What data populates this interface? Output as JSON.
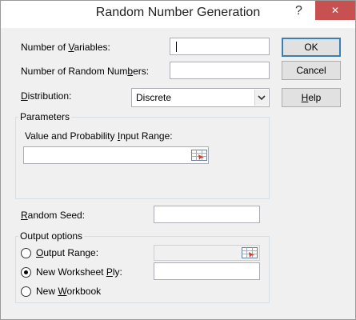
{
  "window": {
    "title": "Random Number Generation",
    "help_glyph": "?",
    "close_glyph": "✕"
  },
  "fields": {
    "num_variables": {
      "pre": "Number of ",
      "key": "V",
      "post": "ariables:",
      "value": ""
    },
    "num_random": {
      "pre": "Number of Random Num",
      "key": "b",
      "post": "ers:",
      "value": ""
    },
    "distribution": {
      "pre": "",
      "key": "D",
      "post": "istribution:",
      "value": "Discrete"
    }
  },
  "buttons": {
    "ok": "OK",
    "cancel": "Cancel",
    "help": {
      "pre": "",
      "key": "H",
      "post": "elp"
    }
  },
  "parameters": {
    "title": "Parameters",
    "range_label": {
      "pre": "Value and Probability ",
      "key": "I",
      "post": "nput Range:"
    },
    "range_value": ""
  },
  "random_seed": {
    "pre": "",
    "key": "R",
    "post": "andom Seed:",
    "value": ""
  },
  "output": {
    "title": "Output options",
    "selected": "new_worksheet_ply",
    "output_range": {
      "pre": "",
      "key": "O",
      "post": "utput Range:",
      "value": ""
    },
    "new_worksheet_ply": {
      "pre": "New Worksheet ",
      "key": "P",
      "post": "ly:",
      "value": ""
    },
    "new_workbook": {
      "pre": "New ",
      "key": "W",
      "post": "orkbook"
    }
  }
}
